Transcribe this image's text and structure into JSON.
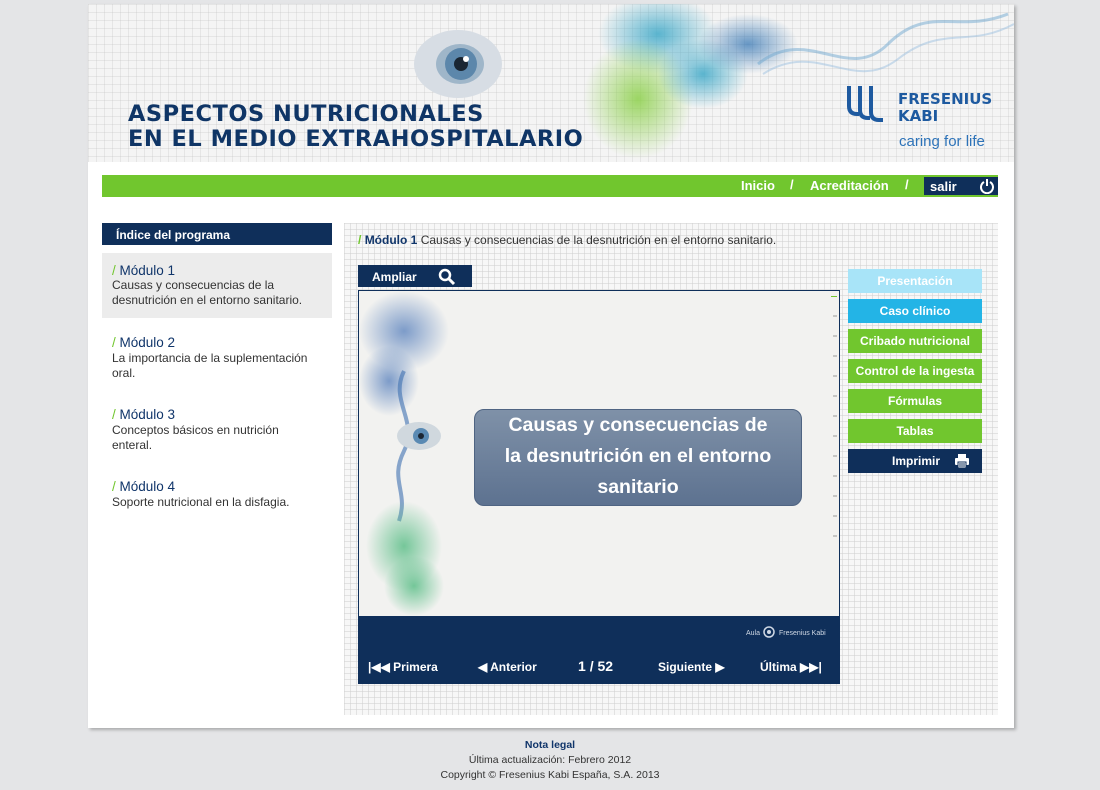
{
  "header": {
    "title_line1": "ASPECTOS NUTRICIONALES",
    "title_line2": "EN EL MEDIO EXTRAHOSPITALARIO",
    "logo_line1": "FRESENIUS",
    "logo_line2": "KABI",
    "tagline": "caring for life"
  },
  "nav": {
    "inicio": "Inicio",
    "separator": "/",
    "acreditacion": "Acreditación",
    "salir": "salir"
  },
  "sidebar": {
    "heading": "Índice del programa",
    "modules": [
      {
        "title": "Módulo 1",
        "desc": "Causas y consecuencias de la desnutrición en el entorno sanitario."
      },
      {
        "title": "Módulo 2",
        "desc": "La importancia de la suplementación oral."
      },
      {
        "title": "Módulo 3",
        "desc": "Conceptos básicos en nutrición enteral."
      },
      {
        "title": "Módulo 4",
        "desc": "Soporte nutricional en la disfagia."
      }
    ]
  },
  "content": {
    "crumb_slash": "/",
    "crumb_module": "Módulo 1",
    "crumb_text": "Causas y consecuencias de la desnutrición en el entorno sanitario.",
    "ampliar": "Ampliar",
    "slide_title_line1": "Causas y consecuencias de",
    "slide_title_line2": "la desnutrición en el entorno",
    "slide_title_line3": "sanitario",
    "slide_brand_aula": "Aula",
    "slide_brand_name": "Fresenius Kabi",
    "pager": {
      "first": "Primera",
      "prev": "Anterior",
      "current": "1",
      "sep": "/",
      "total": "52",
      "next": "Siguiente",
      "last": "Última"
    }
  },
  "side_buttons": {
    "presentacion": "Presentación",
    "caso": "Caso clínico",
    "cribado": "Cribado nutricional",
    "control": "Control de la ingesta",
    "formulas": "Fórmulas",
    "tablas": "Tablas",
    "imprimir": "Imprimir"
  },
  "footer": {
    "legal": "Nota legal",
    "updated": "Última actualización: Febrero 2012",
    "copyright": "Copyright © Fresenius Kabi España, S.A. 2013"
  },
  "colors": {
    "navy": "#0f2f5a",
    "green": "#71c62e",
    "cyan": "#23b4e6",
    "light_cyan": "#a8e4f8"
  }
}
